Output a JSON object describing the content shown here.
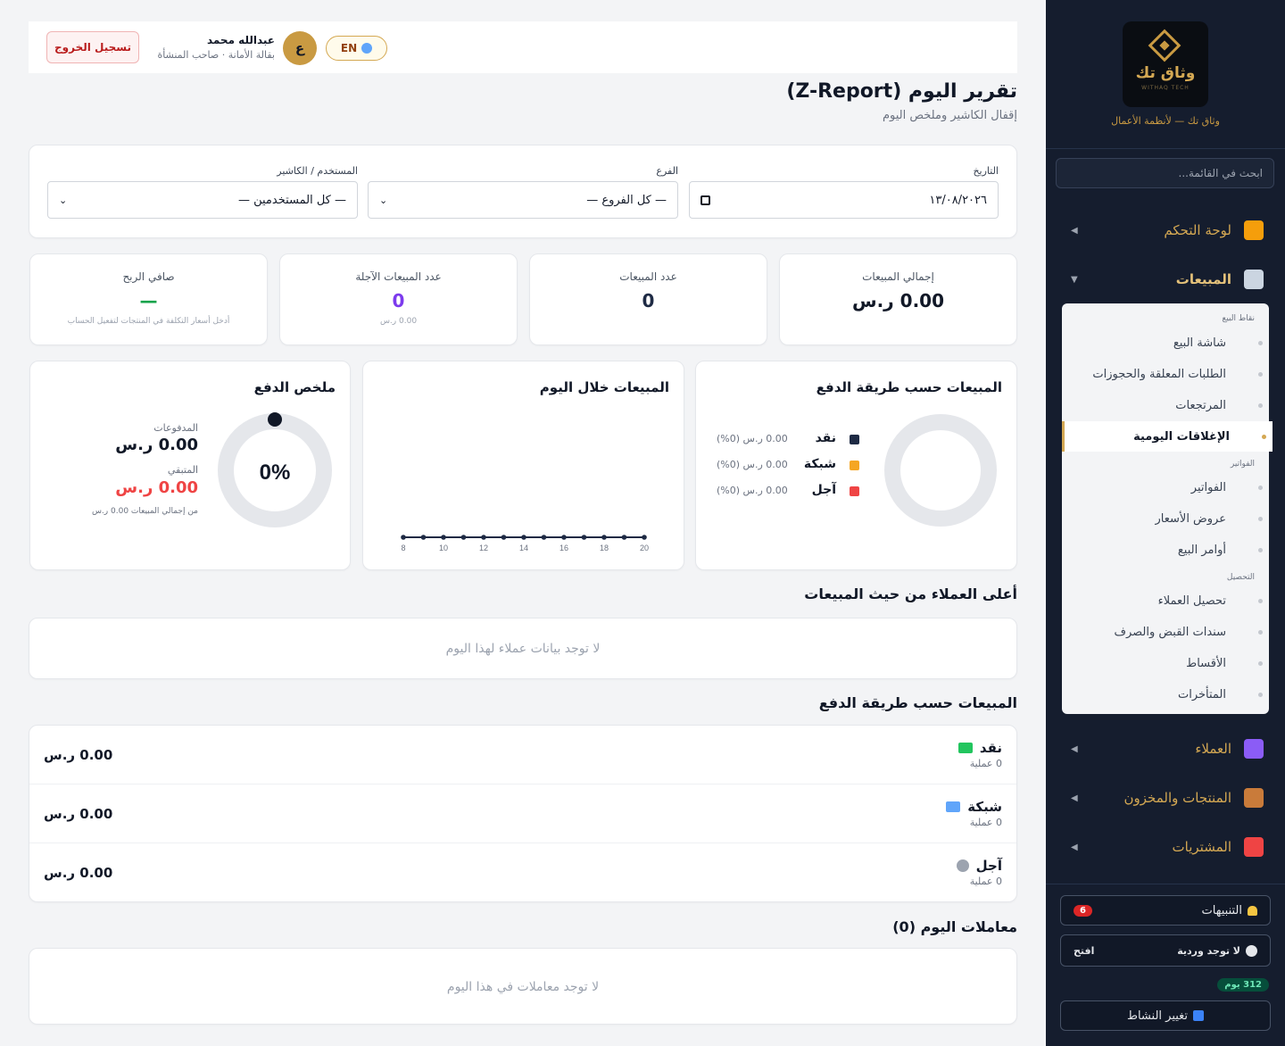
{
  "brand": {
    "logo_text": "وثاق تك",
    "logo_sub": "WITHAQ TECH",
    "tagline": "وثاق تك — لأنظمة الأعمال"
  },
  "sidebar": {
    "search_placeholder": "ابحث في القائمة...",
    "nav": [
      {
        "label": "لوحة التحكم",
        "icon": "home-icon",
        "color": "#f59e0b"
      },
      {
        "label": "المبيعات",
        "icon": "cart-icon",
        "color": "#cbd5e1"
      },
      {
        "label": "العملاء",
        "icon": "users-icon",
        "color": "#8b5cf6"
      },
      {
        "label": "المنتجات والمخزون",
        "icon": "box-icon",
        "color": "#c97b3a"
      },
      {
        "label": "المشتريات",
        "icon": "inbox-icon",
        "color": "#ef4444"
      }
    ],
    "groups": {
      "pos": "نقاط البيع",
      "invoices": "الفواتير",
      "collection": "التحصيل"
    },
    "items": [
      "شاشة البيع",
      "الطلبات المعلقة والحجوزات",
      "المرتجعات",
      "الإغلاقات اليومية",
      "الفواتير",
      "عروض الأسعار",
      "أوامر البيع",
      "تحصيل العملاء",
      "سندات القبض والصرف",
      "الأقساط",
      "المتأخرات"
    ],
    "alerts_label": "التنبيهات",
    "alerts_count": "6",
    "shift_label": "لا توجد وردية",
    "shift_action": "افتح",
    "days_label": "312 يوم",
    "switch_label": "تغيير النشاط"
  },
  "topbar": {
    "logout": "تسجيل الخروج",
    "user_name": "عبدالله محمد",
    "user_sub": "بقالة الأمانة · صاحب المنشأة",
    "avatar": "ع",
    "lang": "EN"
  },
  "page": {
    "title": "تقرير اليوم (Z-Report)",
    "subtitle": "إقفال الكاشير وملخص اليوم"
  },
  "filters": {
    "date_label": "التاريخ",
    "date_value": "١٣/٠٨/٢٠٢٦",
    "branch_label": "الفرع",
    "branch_value": "— كل الفروع —",
    "user_label": "المستخدم / الكاشير",
    "user_value": "— كل المستخدمين —"
  },
  "stats": [
    {
      "label": "إجمالي المبيعات",
      "value": "0.00 ر.س",
      "sub": ""
    },
    {
      "label": "عدد المبيعات",
      "value": "0",
      "sub": ""
    },
    {
      "label": "عدد المبيعات الآجلة",
      "value": "0",
      "sub": "0.00 ر.س"
    },
    {
      "label": "صافي الربح",
      "value": "—",
      "sub": "أدخل أسعار التكلفة في المنتجات لتفعيل الحساب"
    }
  ],
  "panels": {
    "by_method_title": "المبيعات حسب طريقة الدفع",
    "today_title": "المبيعات خلال اليوم",
    "payment_title": "ملخص الدفع",
    "paid_label": "المدفوعات",
    "paid_value": "0.00 ر.س",
    "remaining_label": "المتبقي",
    "remaining_value": "0.00 ر.س",
    "of_total": "من إجمالي المبيعات 0.00 ر.س",
    "percent": "0%"
  },
  "legend": [
    {
      "name": "نقد",
      "amount": "0.00 ر.س (0%)",
      "color": "#1e2a44"
    },
    {
      "name": "شبكة",
      "amount": "0.00 ر.س (0%)",
      "color": "#f5a623"
    },
    {
      "name": "آجل",
      "amount": "0.00 ر.س (0%)",
      "color": "#ef4444"
    }
  ],
  "chart_data": {
    "type": "line",
    "title": "المبيعات خلال اليوم",
    "x": [
      8,
      9,
      10,
      11,
      12,
      13,
      14,
      15,
      16,
      17,
      18,
      19,
      20
    ],
    "x_tick_labels": [
      "8",
      "10",
      "12",
      "14",
      "16",
      "18",
      "20"
    ],
    "series": [
      {
        "values": [
          0,
          0,
          0,
          0,
          0,
          0,
          0,
          0,
          0,
          0,
          0,
          0,
          0
        ]
      }
    ],
    "xlabel": "",
    "ylabel": "",
    "grid": false
  },
  "top_customers": {
    "title": "أعلى العملاء من حيث المبيعات",
    "empty": "لا توجد بيانات عملاء لهذا اليوم"
  },
  "payment_methods": {
    "title": "المبيعات حسب طريقة الدفع",
    "rows": [
      {
        "name": "نقد",
        "count": "0 عملية",
        "value": "0.00 ر.س",
        "icon": "cash-icon",
        "color": "#22c55e"
      },
      {
        "name": "شبكة",
        "count": "0 عملية",
        "value": "0.00 ر.س",
        "icon": "card-icon",
        "color": "#60a5fa"
      },
      {
        "name": "آجل",
        "count": "0 عملية",
        "value": "0.00 ر.س",
        "icon": "clock-icon",
        "color": "#9ca3af"
      }
    ]
  },
  "transactions": {
    "title": "معاملات اليوم (0)",
    "empty": "لا توجد معاملات في هذا اليوم"
  }
}
